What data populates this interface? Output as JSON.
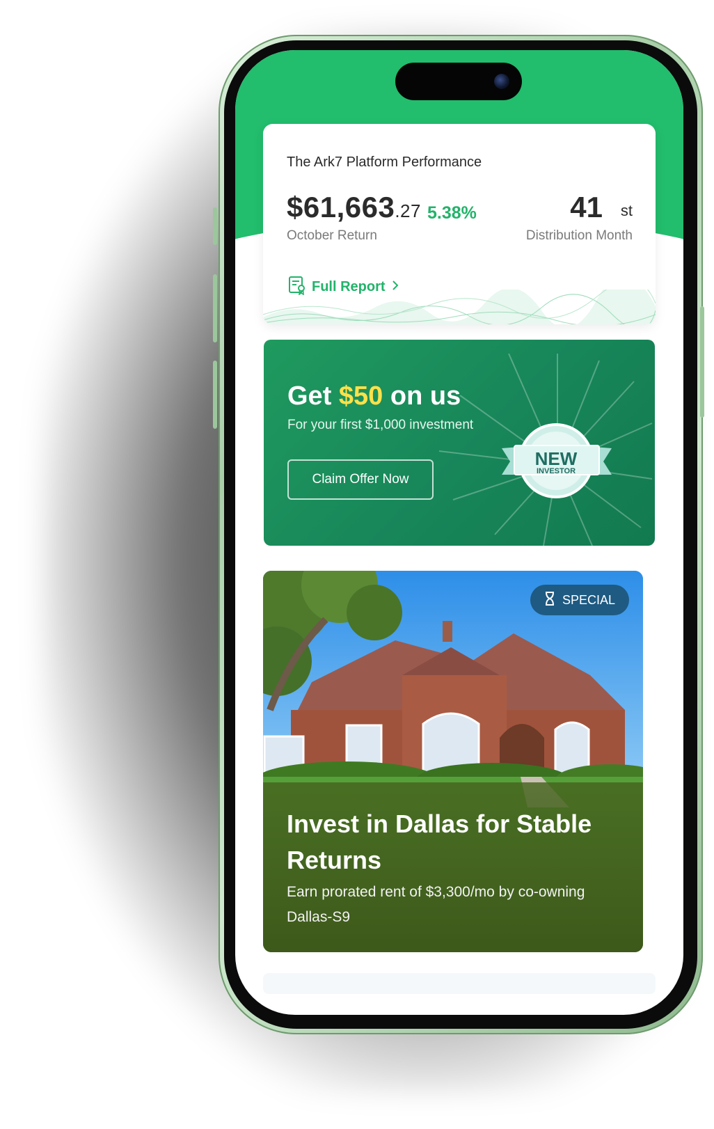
{
  "performance": {
    "title": "The Ark7 Platform Performance",
    "amount_main": "$61,663",
    "amount_cents": ".27",
    "percent": "5.38%",
    "return_label": "October Return",
    "month_number": "41",
    "month_suffix": "st",
    "month_label": "Distribution Month",
    "report_link": "Full Report"
  },
  "promo": {
    "title_prefix": "Get ",
    "title_highlight": "$50",
    "title_suffix": " on us",
    "subtitle": "For your first $1,000 investment",
    "button": "Claim Offer Now",
    "badge_line1": "NEW",
    "badge_line2": "INVESTOR"
  },
  "listing": {
    "tag": "SPECIAL",
    "title": "Invest in Dallas for Stable Returns",
    "subtitle": "Earn prorated rent of $3,300/mo by co-owning Dallas-S9"
  },
  "colors": {
    "brand_green": "#22bd6d",
    "accent_green": "#22b36a",
    "promo_green": "#18875a",
    "highlight_yellow": "#ffe14a",
    "tag_blue": "#1e5a82"
  },
  "icons": {
    "report": "document-certificate-icon",
    "chevron": "chevron-right-icon",
    "tag": "hourglass-icon"
  }
}
